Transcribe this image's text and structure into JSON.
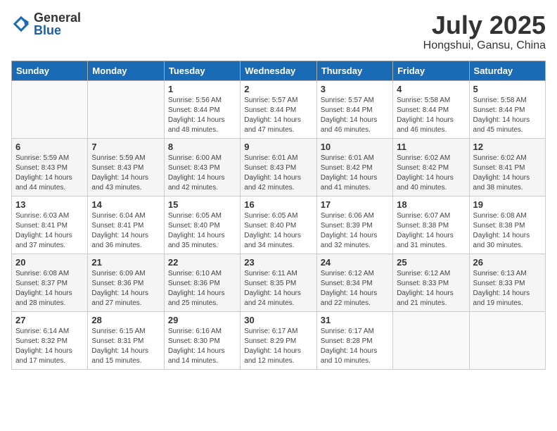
{
  "logo": {
    "general": "General",
    "blue": "Blue"
  },
  "title": "July 2025",
  "location": "Hongshui, Gansu, China",
  "days_of_week": [
    "Sunday",
    "Monday",
    "Tuesday",
    "Wednesday",
    "Thursday",
    "Friday",
    "Saturday"
  ],
  "weeks": [
    [
      {
        "day": "",
        "info": ""
      },
      {
        "day": "",
        "info": ""
      },
      {
        "day": "1",
        "info": "Sunrise: 5:56 AM\nSunset: 8:44 PM\nDaylight: 14 hours and 48 minutes."
      },
      {
        "day": "2",
        "info": "Sunrise: 5:57 AM\nSunset: 8:44 PM\nDaylight: 14 hours and 47 minutes."
      },
      {
        "day": "3",
        "info": "Sunrise: 5:57 AM\nSunset: 8:44 PM\nDaylight: 14 hours and 46 minutes."
      },
      {
        "day": "4",
        "info": "Sunrise: 5:58 AM\nSunset: 8:44 PM\nDaylight: 14 hours and 46 minutes."
      },
      {
        "day": "5",
        "info": "Sunrise: 5:58 AM\nSunset: 8:44 PM\nDaylight: 14 hours and 45 minutes."
      }
    ],
    [
      {
        "day": "6",
        "info": "Sunrise: 5:59 AM\nSunset: 8:43 PM\nDaylight: 14 hours and 44 minutes."
      },
      {
        "day": "7",
        "info": "Sunrise: 5:59 AM\nSunset: 8:43 PM\nDaylight: 14 hours and 43 minutes."
      },
      {
        "day": "8",
        "info": "Sunrise: 6:00 AM\nSunset: 8:43 PM\nDaylight: 14 hours and 42 minutes."
      },
      {
        "day": "9",
        "info": "Sunrise: 6:01 AM\nSunset: 8:43 PM\nDaylight: 14 hours and 42 minutes."
      },
      {
        "day": "10",
        "info": "Sunrise: 6:01 AM\nSunset: 8:42 PM\nDaylight: 14 hours and 41 minutes."
      },
      {
        "day": "11",
        "info": "Sunrise: 6:02 AM\nSunset: 8:42 PM\nDaylight: 14 hours and 40 minutes."
      },
      {
        "day": "12",
        "info": "Sunrise: 6:02 AM\nSunset: 8:41 PM\nDaylight: 14 hours and 38 minutes."
      }
    ],
    [
      {
        "day": "13",
        "info": "Sunrise: 6:03 AM\nSunset: 8:41 PM\nDaylight: 14 hours and 37 minutes."
      },
      {
        "day": "14",
        "info": "Sunrise: 6:04 AM\nSunset: 8:41 PM\nDaylight: 14 hours and 36 minutes."
      },
      {
        "day": "15",
        "info": "Sunrise: 6:05 AM\nSunset: 8:40 PM\nDaylight: 14 hours and 35 minutes."
      },
      {
        "day": "16",
        "info": "Sunrise: 6:05 AM\nSunset: 8:40 PM\nDaylight: 14 hours and 34 minutes."
      },
      {
        "day": "17",
        "info": "Sunrise: 6:06 AM\nSunset: 8:39 PM\nDaylight: 14 hours and 32 minutes."
      },
      {
        "day": "18",
        "info": "Sunrise: 6:07 AM\nSunset: 8:38 PM\nDaylight: 14 hours and 31 minutes."
      },
      {
        "day": "19",
        "info": "Sunrise: 6:08 AM\nSunset: 8:38 PM\nDaylight: 14 hours and 30 minutes."
      }
    ],
    [
      {
        "day": "20",
        "info": "Sunrise: 6:08 AM\nSunset: 8:37 PM\nDaylight: 14 hours and 28 minutes."
      },
      {
        "day": "21",
        "info": "Sunrise: 6:09 AM\nSunset: 8:36 PM\nDaylight: 14 hours and 27 minutes."
      },
      {
        "day": "22",
        "info": "Sunrise: 6:10 AM\nSunset: 8:36 PM\nDaylight: 14 hours and 25 minutes."
      },
      {
        "day": "23",
        "info": "Sunrise: 6:11 AM\nSunset: 8:35 PM\nDaylight: 14 hours and 24 minutes."
      },
      {
        "day": "24",
        "info": "Sunrise: 6:12 AM\nSunset: 8:34 PM\nDaylight: 14 hours and 22 minutes."
      },
      {
        "day": "25",
        "info": "Sunrise: 6:12 AM\nSunset: 8:33 PM\nDaylight: 14 hours and 21 minutes."
      },
      {
        "day": "26",
        "info": "Sunrise: 6:13 AM\nSunset: 8:33 PM\nDaylight: 14 hours and 19 minutes."
      }
    ],
    [
      {
        "day": "27",
        "info": "Sunrise: 6:14 AM\nSunset: 8:32 PM\nDaylight: 14 hours and 17 minutes."
      },
      {
        "day": "28",
        "info": "Sunrise: 6:15 AM\nSunset: 8:31 PM\nDaylight: 14 hours and 15 minutes."
      },
      {
        "day": "29",
        "info": "Sunrise: 6:16 AM\nSunset: 8:30 PM\nDaylight: 14 hours and 14 minutes."
      },
      {
        "day": "30",
        "info": "Sunrise: 6:17 AM\nSunset: 8:29 PM\nDaylight: 14 hours and 12 minutes."
      },
      {
        "day": "31",
        "info": "Sunrise: 6:17 AM\nSunset: 8:28 PM\nDaylight: 14 hours and 10 minutes."
      },
      {
        "day": "",
        "info": ""
      },
      {
        "day": "",
        "info": ""
      }
    ]
  ]
}
